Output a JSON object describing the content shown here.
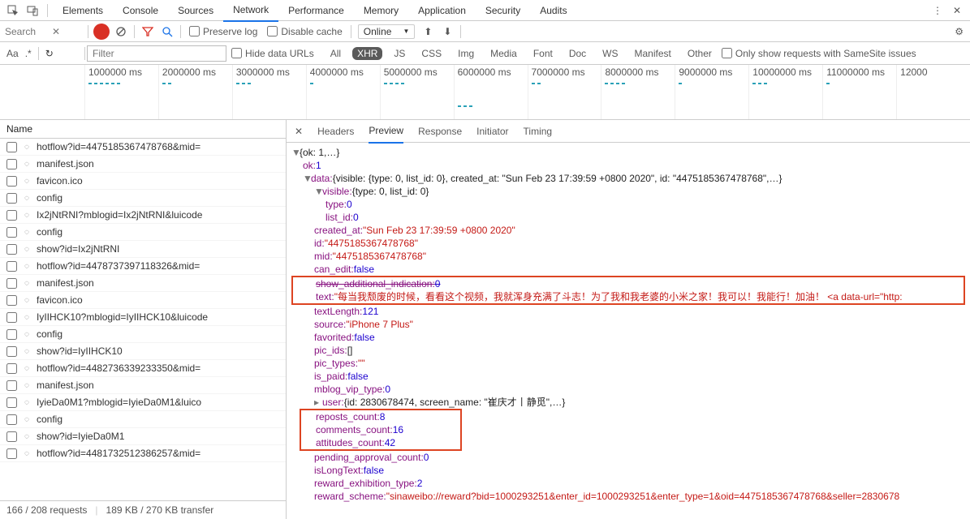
{
  "top_tabs": [
    "Elements",
    "Console",
    "Sources",
    "Network",
    "Performance",
    "Memory",
    "Application",
    "Security",
    "Audits"
  ],
  "top_active": "Network",
  "search": {
    "placeholder": "Search"
  },
  "toolbar": {
    "preserve": "Preserve log",
    "disable": "Disable cache",
    "online": "Online"
  },
  "filter": {
    "placeholder": "Filter",
    "hide": "Hide data URLs",
    "types": [
      "All",
      "XHR",
      "JS",
      "CSS",
      "Img",
      "Media",
      "Font",
      "Doc",
      "WS",
      "Manifest",
      "Other"
    ],
    "active": "XHR",
    "samesite": "Only show requests with SameSite issues"
  },
  "timeline": [
    "1000000 ms",
    "2000000 ms",
    "3000000 ms",
    "4000000 ms",
    "5000000 ms",
    "6000000 ms",
    "7000000 ms",
    "8000000 ms",
    "9000000 ms",
    "10000000 ms",
    "11000000 ms",
    "12000"
  ],
  "name_header": "Name",
  "requests": [
    "hotflow?id=4475185367478768&mid=",
    "manifest.json",
    "favicon.ico",
    "config",
    "Ix2jNtRNI?mblogid=Ix2jNtRNI&luicode",
    "config",
    "show?id=Ix2jNtRNI",
    "hotflow?id=4478737397118326&mid=",
    "manifest.json",
    "favicon.ico",
    "IyIIHCK10?mblogid=IyIIHCK10&luicode",
    "config",
    "show?id=IyIIHCK10",
    "hotflow?id=4482736339233350&mid=",
    "manifest.json",
    "IyieDa0M1?mblogid=IyieDa0M1&luico",
    "config",
    "show?id=IyieDa0M1",
    "hotflow?id=4481732512386257&mid="
  ],
  "status": {
    "count": "166 / 208 requests",
    "transfer": "189 KB / 270 KB transfer"
  },
  "detail_tabs": [
    "Headers",
    "Preview",
    "Response",
    "Initiator",
    "Timing"
  ],
  "detail_active": "Preview",
  "json": {
    "root": "{ok: 1,…}",
    "ok": "ok: ",
    "ok_v": "1",
    "data": "data: ",
    "data_v": "{visible: {type: 0, list_id: 0}, created_at: \"Sun Feb 23 17:39:59 +0800 2020\", id: \"4475185367478768\",…}",
    "visible": "visible: ",
    "visible_v": "{type: 0, list_id: 0}",
    "type": "type: ",
    "type_v": "0",
    "list_id": "list_id: ",
    "list_id_v": "0",
    "created_at": "created_at: ",
    "created_at_v": "\"Sun Feb 23 17:39:59 +0800 2020\"",
    "id": "id: ",
    "id_v": "\"4475185367478768\"",
    "mid": "mid: ",
    "mid_v": "\"4475185367478768\"",
    "can_edit": "can_edit: ",
    "can_edit_v": "false",
    "sai": "show_additional_indication: ",
    "sai_v": "0",
    "text": "text: ",
    "text_v": "\"每当我颓废的时候，看看这个视频，我就浑身充满了斗志！为了我和我老婆的小米之家！我可以！我能行！加油！ <a data-url=\"http:",
    "textLength": "textLength: ",
    "textLength_v": "121",
    "source": "source: ",
    "source_v": "\"iPhone 7 Plus\"",
    "favorited": "favorited: ",
    "favorited_v": "false",
    "pic_ids": "pic_ids: ",
    "pic_ids_v": "[]",
    "pic_types": "pic_types: ",
    "pic_types_v": "\"\"",
    "is_paid": "is_paid: ",
    "is_paid_v": "false",
    "mblog_vip": "mblog_vip_type: ",
    "mblog_vip_v": "0",
    "user": "user: ",
    "user_v": "{id: 2830678474, screen_name: \"崔庆才丨静觅\",…}",
    "reposts": "reposts_count: ",
    "reposts_v": "8",
    "comments": "comments_count: ",
    "comments_v": "16",
    "attitudes": "attitudes_count: ",
    "attitudes_v": "42",
    "pending": "pending_approval_count: ",
    "pending_v": "0",
    "isLong": "isLongText: ",
    "isLong_v": "false",
    "ret": "reward_exhibition_type: ",
    "ret_v": "2",
    "rs": "reward_scheme: ",
    "rs_v": "\"sinaweibo://reward?bid=1000293251&enter_id=1000293251&enter_type=1&oid=4475185367478768&seller=2830678"
  }
}
